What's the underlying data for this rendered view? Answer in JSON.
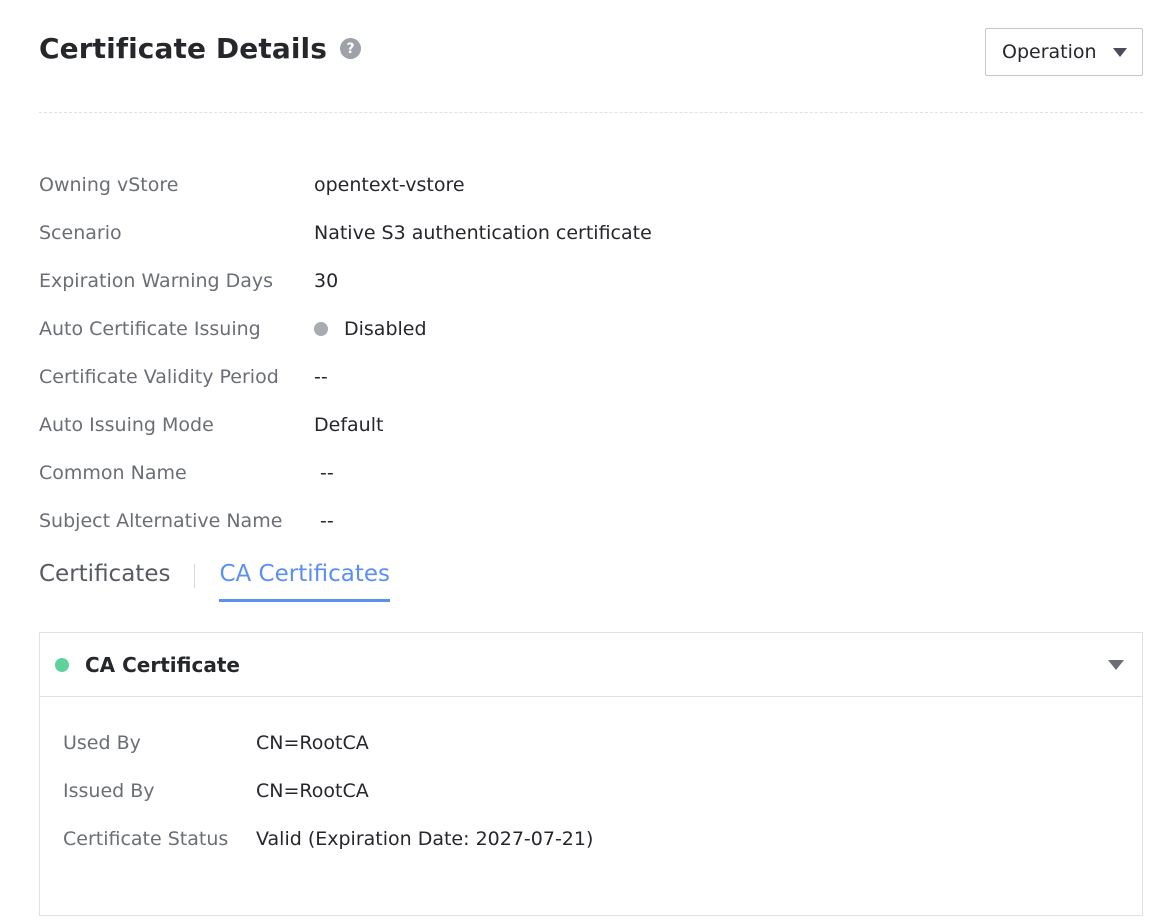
{
  "header": {
    "title": "Certificate Details",
    "help_icon": "?",
    "operation_label": "Operation"
  },
  "properties": [
    {
      "label": "Owning vStore",
      "value": "opentext-vstore"
    },
    {
      "label": "Scenario",
      "value": "Native S3 authentication certificate"
    },
    {
      "label": "Expiration Warning Days",
      "value": "30"
    },
    {
      "label": "Auto Certificate Issuing",
      "value": "Disabled",
      "status_color": "#a8abb2"
    },
    {
      "label": "Certificate Validity Period",
      "value": "--"
    },
    {
      "label": "Auto Issuing Mode",
      "value": "Default"
    },
    {
      "label": "Common Name",
      "value": "--"
    },
    {
      "label": "Subject Alternative Name",
      "value": "--"
    }
  ],
  "tabs": [
    {
      "label": "Certificates",
      "active": false
    },
    {
      "label": "CA Certificates",
      "active": true
    }
  ],
  "ca_card": {
    "title": "CA Certificate",
    "status_color": "#5fd29a",
    "rows": [
      {
        "label": "Used By",
        "value": "CN=RootCA"
      },
      {
        "label": "Issued By",
        "value": "CN=RootCA"
      },
      {
        "label": "Certificate Status",
        "value": "Valid (Expiration Date: 2027-07-21)"
      }
    ]
  },
  "colors": {
    "accent": "#5b8ff0",
    "disabled_status": "#a8abb2",
    "valid_status": "#5fd29a"
  },
  "icons": {
    "help": "help-icon",
    "operation_caret": "caret-down-icon",
    "card_collapse": "chevron-down-icon"
  }
}
